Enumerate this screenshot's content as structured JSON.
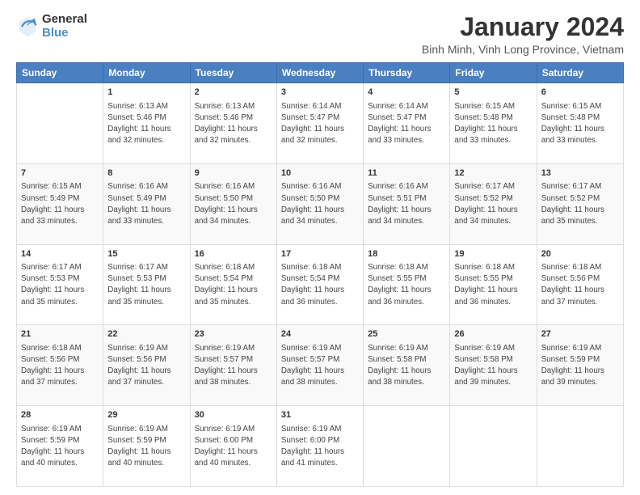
{
  "logo": {
    "general": "General",
    "blue": "Blue"
  },
  "header": {
    "title": "January 2024",
    "subtitle": "Binh Minh, Vinh Long Province, Vietnam"
  },
  "weekdays": [
    "Sunday",
    "Monday",
    "Tuesday",
    "Wednesday",
    "Thursday",
    "Friday",
    "Saturday"
  ],
  "weeks": [
    [
      {
        "day": "",
        "info": ""
      },
      {
        "day": "1",
        "info": "Sunrise: 6:13 AM\nSunset: 5:46 PM\nDaylight: 11 hours\nand 32 minutes."
      },
      {
        "day": "2",
        "info": "Sunrise: 6:13 AM\nSunset: 5:46 PM\nDaylight: 11 hours\nand 32 minutes."
      },
      {
        "day": "3",
        "info": "Sunrise: 6:14 AM\nSunset: 5:47 PM\nDaylight: 11 hours\nand 32 minutes."
      },
      {
        "day": "4",
        "info": "Sunrise: 6:14 AM\nSunset: 5:47 PM\nDaylight: 11 hours\nand 33 minutes."
      },
      {
        "day": "5",
        "info": "Sunrise: 6:15 AM\nSunset: 5:48 PM\nDaylight: 11 hours\nand 33 minutes."
      },
      {
        "day": "6",
        "info": "Sunrise: 6:15 AM\nSunset: 5:48 PM\nDaylight: 11 hours\nand 33 minutes."
      }
    ],
    [
      {
        "day": "7",
        "info": "Sunrise: 6:15 AM\nSunset: 5:49 PM\nDaylight: 11 hours\nand 33 minutes."
      },
      {
        "day": "8",
        "info": "Sunrise: 6:16 AM\nSunset: 5:49 PM\nDaylight: 11 hours\nand 33 minutes."
      },
      {
        "day": "9",
        "info": "Sunrise: 6:16 AM\nSunset: 5:50 PM\nDaylight: 11 hours\nand 34 minutes."
      },
      {
        "day": "10",
        "info": "Sunrise: 6:16 AM\nSunset: 5:50 PM\nDaylight: 11 hours\nand 34 minutes."
      },
      {
        "day": "11",
        "info": "Sunrise: 6:16 AM\nSunset: 5:51 PM\nDaylight: 11 hours\nand 34 minutes."
      },
      {
        "day": "12",
        "info": "Sunrise: 6:17 AM\nSunset: 5:52 PM\nDaylight: 11 hours\nand 34 minutes."
      },
      {
        "day": "13",
        "info": "Sunrise: 6:17 AM\nSunset: 5:52 PM\nDaylight: 11 hours\nand 35 minutes."
      }
    ],
    [
      {
        "day": "14",
        "info": "Sunrise: 6:17 AM\nSunset: 5:53 PM\nDaylight: 11 hours\nand 35 minutes."
      },
      {
        "day": "15",
        "info": "Sunrise: 6:17 AM\nSunset: 5:53 PM\nDaylight: 11 hours\nand 35 minutes."
      },
      {
        "day": "16",
        "info": "Sunrise: 6:18 AM\nSunset: 5:54 PM\nDaylight: 11 hours\nand 35 minutes."
      },
      {
        "day": "17",
        "info": "Sunrise: 6:18 AM\nSunset: 5:54 PM\nDaylight: 11 hours\nand 36 minutes."
      },
      {
        "day": "18",
        "info": "Sunrise: 6:18 AM\nSunset: 5:55 PM\nDaylight: 11 hours\nand 36 minutes."
      },
      {
        "day": "19",
        "info": "Sunrise: 6:18 AM\nSunset: 5:55 PM\nDaylight: 11 hours\nand 36 minutes."
      },
      {
        "day": "20",
        "info": "Sunrise: 6:18 AM\nSunset: 5:56 PM\nDaylight: 11 hours\nand 37 minutes."
      }
    ],
    [
      {
        "day": "21",
        "info": "Sunrise: 6:18 AM\nSunset: 5:56 PM\nDaylight: 11 hours\nand 37 minutes."
      },
      {
        "day": "22",
        "info": "Sunrise: 6:19 AM\nSunset: 5:56 PM\nDaylight: 11 hours\nand 37 minutes."
      },
      {
        "day": "23",
        "info": "Sunrise: 6:19 AM\nSunset: 5:57 PM\nDaylight: 11 hours\nand 38 minutes."
      },
      {
        "day": "24",
        "info": "Sunrise: 6:19 AM\nSunset: 5:57 PM\nDaylight: 11 hours\nand 38 minutes."
      },
      {
        "day": "25",
        "info": "Sunrise: 6:19 AM\nSunset: 5:58 PM\nDaylight: 11 hours\nand 38 minutes."
      },
      {
        "day": "26",
        "info": "Sunrise: 6:19 AM\nSunset: 5:58 PM\nDaylight: 11 hours\nand 39 minutes."
      },
      {
        "day": "27",
        "info": "Sunrise: 6:19 AM\nSunset: 5:59 PM\nDaylight: 11 hours\nand 39 minutes."
      }
    ],
    [
      {
        "day": "28",
        "info": "Sunrise: 6:19 AM\nSunset: 5:59 PM\nDaylight: 11 hours\nand 40 minutes."
      },
      {
        "day": "29",
        "info": "Sunrise: 6:19 AM\nSunset: 5:59 PM\nDaylight: 11 hours\nand 40 minutes."
      },
      {
        "day": "30",
        "info": "Sunrise: 6:19 AM\nSunset: 6:00 PM\nDaylight: 11 hours\nand 40 minutes."
      },
      {
        "day": "31",
        "info": "Sunrise: 6:19 AM\nSunset: 6:00 PM\nDaylight: 11 hours\nand 41 minutes."
      },
      {
        "day": "",
        "info": ""
      },
      {
        "day": "",
        "info": ""
      },
      {
        "day": "",
        "info": ""
      }
    ]
  ]
}
